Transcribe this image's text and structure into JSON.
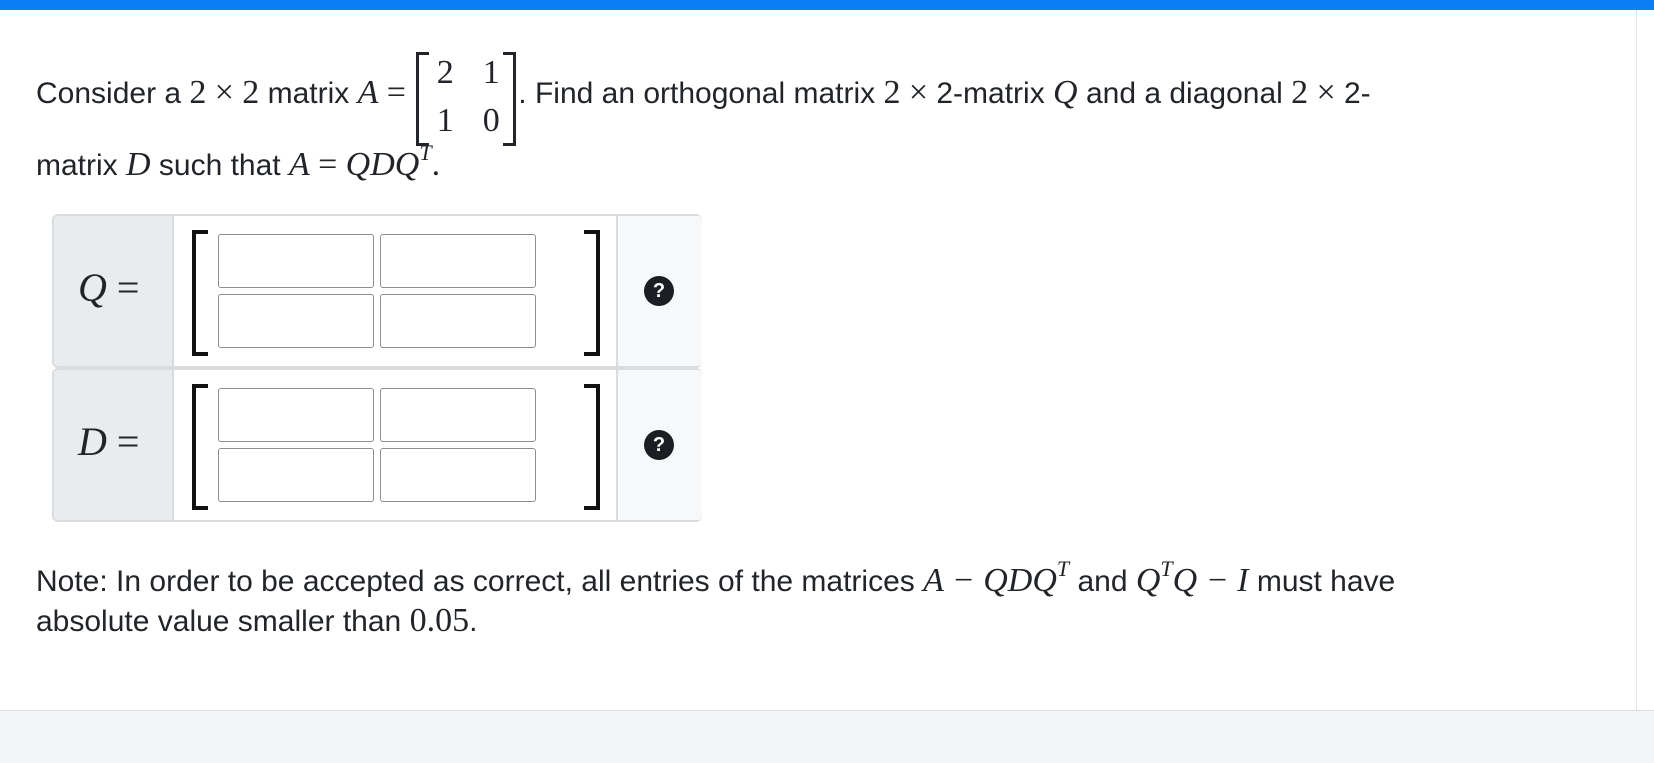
{
  "problem": {
    "t1": "Consider a ",
    "two_a": "2",
    "times_a": "×",
    "two_b": "2",
    "t2": " matrix ",
    "var_A": "A",
    "eq": "=",
    "matrix": {
      "a11": "2",
      "a12": "1",
      "a21": "1",
      "a22": "0"
    },
    "t3": ". Find an orthogonal matrix ",
    "two_c": "2",
    "times_b": "×",
    "t4": "2-matrix ",
    "var_Q": "Q",
    "t5": " and a diagonal ",
    "two_d": "2",
    "times_c": "×",
    "t6": "2-",
    "t7": "matrix ",
    "var_D": "D",
    "t8": " such that ",
    "var_A2": "A",
    "eq2": "=",
    "qdq": "QDQ",
    "sup_T": "T",
    "period": "."
  },
  "answers": {
    "Q": {
      "label": "Q",
      "eq": "=",
      "cells": [
        [
          "",
          ""
        ],
        [
          "",
          ""
        ]
      ],
      "help": "?"
    },
    "D": {
      "label": "D",
      "eq": "=",
      "cells": [
        [
          "",
          ""
        ],
        [
          "",
          ""
        ]
      ],
      "help": "?"
    }
  },
  "note": {
    "t1": "Note: In order to be accepted as correct, all entries of the matrices ",
    "m1": "A − QDQ",
    "sup1": "T",
    "t2": " and ",
    "m2a": "Q",
    "sup2": "T",
    "m2b": "Q − I",
    "t3": " must have",
    "t4": "absolute value smaller than ",
    "val": "0.05",
    "period": "."
  },
  "colors": {
    "topbar": "#0d7ff5",
    "label_bg": "#e9ecef",
    "help_icon": "#1b1f23"
  }
}
